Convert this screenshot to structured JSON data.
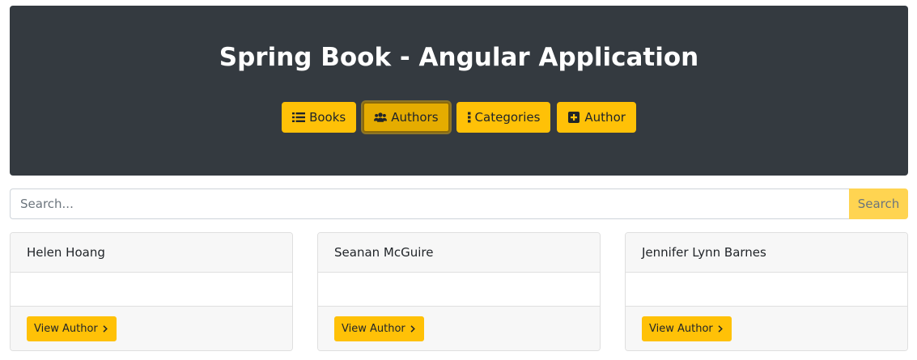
{
  "header": {
    "title": "Spring Book - Angular Application",
    "background": "#343a40",
    "nav": [
      {
        "label": "Books",
        "icon": "list-icon",
        "active": false
      },
      {
        "label": "Authors",
        "icon": "users-icon",
        "active": true
      },
      {
        "label": "Categories",
        "icon": "ellipsis-vertical-icon",
        "active": false
      },
      {
        "label": "Author",
        "icon": "plus-square-icon",
        "active": false
      }
    ]
  },
  "search": {
    "placeholder": "Search...",
    "value": "",
    "button_label": "Search"
  },
  "authors": [
    {
      "name": "Helen Hoang",
      "button_label": "View Author",
      "button_icon": "chevron-right-icon"
    },
    {
      "name": "Seanan McGuire",
      "button_label": "View Author",
      "button_icon": "chevron-right-icon"
    },
    {
      "name": "Jennifer Lynn Barnes",
      "button_label": "View Author",
      "button_icon": "chevron-right-icon"
    }
  ],
  "colors": {
    "accent": "#ffc107",
    "search_button": "#ffd451",
    "card_header": "#f7f7f7"
  }
}
